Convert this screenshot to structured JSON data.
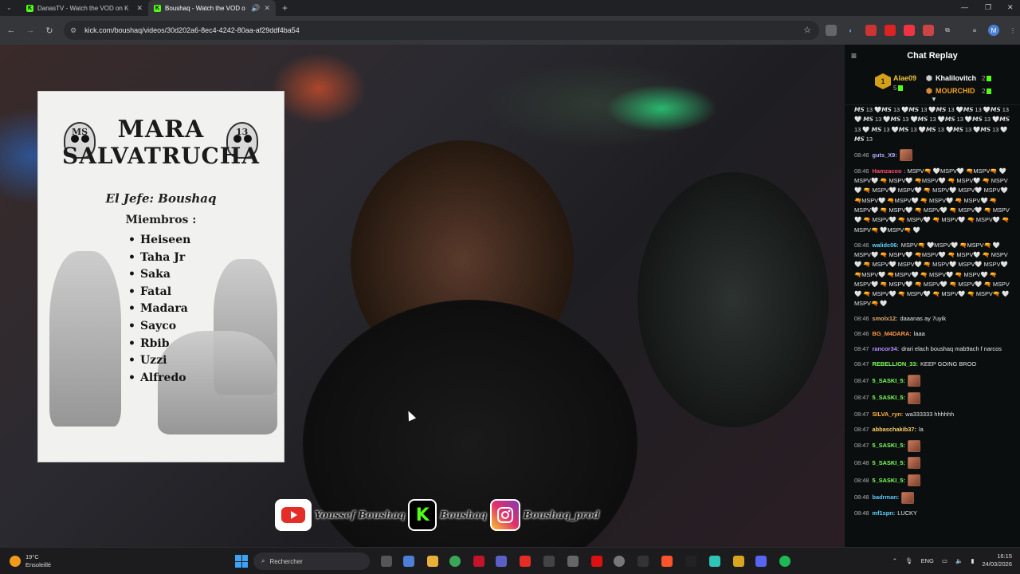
{
  "browser": {
    "tabs": [
      {
        "title": "DanasTV - Watch the VOD on K"
      },
      {
        "title": "Boushaq - Watch the VOD o"
      }
    ],
    "url": "kick.com/boushaq/videos/30d202a6-8ec4-4242-80aa-af29ddf4ba54"
  },
  "poster": {
    "title_line1": "MARA",
    "title_line2": "SALVATRUCHA",
    "tag_left": "MS",
    "tag_right": "13",
    "jefe": "El Jefe: Boushaq",
    "members_heading": "Miembros :",
    "members": [
      "Heiseen",
      "Taha Jr",
      "Saka",
      "Fatal",
      "Madara",
      "Sayco",
      "Rbib",
      "Uzzi",
      "Alfredo"
    ]
  },
  "social": {
    "youtube": "Youssef Boushaq",
    "kick": "Boushaq",
    "instagram": "Boushaq_prod"
  },
  "chat": {
    "title": "Chat Replay",
    "leaderboard": {
      "first": {
        "rank": "1",
        "name": "Alae09",
        "count": "5"
      },
      "second": {
        "name": "Khalilovitch",
        "count": "2"
      },
      "third": {
        "name": "MOURCHID",
        "count": "2"
      }
    },
    "spam_top": "𝙈𝙎 13 🤍𝙈𝙎 13 🤍𝙈𝙎 13 🤍𝙈𝙎 13 🤍𝙈𝙎 13 🤍𝙈𝙎 13 🤍 𝙈𝙎 13 🤍𝙈𝙎 13 🤍𝙈𝙎 13 🤍𝙈𝙎 13 🤍𝙈𝙎 13 🤍𝙈𝙎 13 🤍 𝙈𝙎 13 🤍𝙈𝙎 13 🤍𝙈𝙎 13 🤍𝙈𝙎 13 🤍𝙈𝙎 13 🤍𝙈𝙎 13",
    "messages": [
      {
        "time": "08:46",
        "user": "guts_X9:",
        "color": "#b9a9ff",
        "text": "",
        "emote": true
      },
      {
        "time": "08:46",
        "user": "Hamzacoo",
        "color": "#ff4d6d",
        "text": ": MSPV🔫 🤍MSPV🤍 🔫MSPV🔫 🤍 MSPV🤍 🔫 MSPV🤍 🔫MSPV🤍 🔫 MSPV🤍 🔫 MSPV🤍 🔫 MSPV🤍 MSPV🤍 🔫 MSPV🤍 MSPV🤍 MSPV🤍 🔫MSPV🤍 🔫MSPV🤍 🔫 MSPV🤍 🔫 MSPV🤍 🔫 MSPV🤍 🔫 MSPV🤍 🔫 MSPV🤍 🔫 MSPV🤍 🔫 MSPV🤍 🔫 MSPV🤍 🔫 MSPV🤍 🔫 MSPV🤍 🔫 MSPV🤍 🔫 MSPV🔫 🤍MSPV🔫 🤍",
        "emote": false
      },
      {
        "time": "08:46",
        "user": "walidc06:",
        "color": "#5cd6ff",
        "text": "MSPV🔫 🤍MSPV🤍 🔫MSPV🔫 🤍 MSPV🤍 🔫 MSPV🤍 🔫MSPV🤍 🔫 MSPV🤍 🔫 MSPV🤍 🔫 MSPV🤍 MSPV🤍 🔫 MSPV🤍 MSPV🤍 MSPV🤍 🔫MSPV🤍 🔫MSPV🤍 🔫 MSPV🤍 🔫 MSPV🤍 🔫 MSPV🤍 🔫 MSPV🤍 🔫 MSPV🤍 🔫 MSPV🤍 🔫 MSPV🤍 🔫 MSPV🤍 🔫 MSPV🤍 🔫 MSPV🤍 🔫 MSPV🔫 🤍MSPV🔫 🤍",
        "emote": false
      },
      {
        "time": "08:46",
        "user": "smolx12:",
        "color": "#e0a96d",
        "text": "daaanas ay 7uyik",
        "emote": false
      },
      {
        "time": "08:46",
        "user": "BG_M4DARA:",
        "color": "#ff9340",
        "text": "laaa",
        "emote": false
      },
      {
        "time": "08:47",
        "user": "rancor34:",
        "color": "#b48cff",
        "text": "drari elach boushaq mab9ach f narcos",
        "emote": false
      },
      {
        "time": "08:47",
        "user": "REBELLION_33:",
        "color": "#7bff5a",
        "text": "KEEP GOING BROO",
        "emote": false
      },
      {
        "time": "08:47",
        "user": "5_SASKI_5:",
        "color": "#7bff5a",
        "text": "",
        "emote": true
      },
      {
        "time": "08:47",
        "user": "5_SASKI_5:",
        "color": "#7bff5a",
        "text": "",
        "emote": true
      },
      {
        "time": "08:47",
        "user": "SILVA_ryn:",
        "color": "#ffb347",
        "text": "wa333333 hhhhhh",
        "emote": false
      },
      {
        "time": "08:47",
        "user": "abbaschakib37:",
        "color": "#ffcf66",
        "text": "la",
        "emote": false
      },
      {
        "time": "08:47",
        "user": "5_SASKI_5:",
        "color": "#7bff5a",
        "text": "",
        "emote": true
      },
      {
        "time": "08:48",
        "user": "5_SASKI_5:",
        "color": "#7bff5a",
        "text": "",
        "emote": true
      },
      {
        "time": "08:48",
        "user": "5_SASKI_5:",
        "color": "#7bff5a",
        "text": "",
        "emote": true
      },
      {
        "time": "08:48",
        "user": "badrman:",
        "color": "#5cc9ff",
        "text": "",
        "emote": true
      },
      {
        "time": "08:48",
        "user": "mf1spn:",
        "color": "#5cd6ff",
        "text": "LUCKY",
        "emote": false
      }
    ]
  },
  "taskbar": {
    "temp": "19°C",
    "weather": "Ensoleillé",
    "search": "Rechercher",
    "lang": "ENG",
    "time": "16:15",
    "date": "24/03/2026"
  }
}
